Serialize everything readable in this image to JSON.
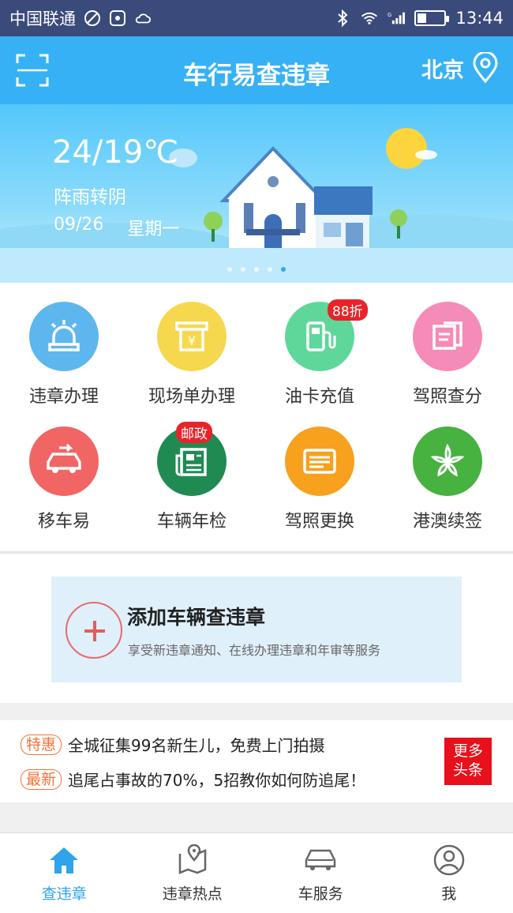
{
  "status_bar": {
    "carrier": "中国联通",
    "time": "13:44",
    "battery_level": 0.35
  },
  "header": {
    "title": "车行易查违章",
    "city": "北京"
  },
  "banner": {
    "temperature": "24/19℃",
    "weather": "阵雨转阴",
    "date": "09/26",
    "weekday": "星期一",
    "slide_count": 5,
    "active_slide": 4
  },
  "grid": {
    "items": [
      {
        "label": "违章办理",
        "icon": "siren-icon",
        "color": "#5db7ee"
      },
      {
        "label": "现场单办理",
        "icon": "receipt-icon",
        "color": "#f5d84e"
      },
      {
        "label": "油卡充值",
        "icon": "fuel-pump-icon",
        "color": "#5fd79b",
        "badge": "88折"
      },
      {
        "label": "驾照查分",
        "icon": "license-book-icon",
        "color": "#f58bb7"
      },
      {
        "label": "移车易",
        "icon": "car-move-icon",
        "color": "#f16565"
      },
      {
        "label": "车辆年检",
        "icon": "newspaper-icon",
        "color": "#1f8b53",
        "badge": "邮政"
      },
      {
        "label": "驾照更换",
        "icon": "id-card-icon",
        "color": "#f7a11e"
      },
      {
        "label": "港澳续签",
        "icon": "bauhinia-icon",
        "color": "#47b23f"
      }
    ]
  },
  "add_vehicle": {
    "title": "添加车辆查违章",
    "subtitle": "享受新违章通知、在线办理违章和年审等服务"
  },
  "news": {
    "items": [
      {
        "tag": "特惠",
        "text": "全城征集99名新生儿，免费上门拍摄"
      },
      {
        "tag": "最新",
        "text": "追尾占事故的70%，5招教你如何防追尾！"
      }
    ],
    "more_line1": "更多",
    "more_line2": "头条"
  },
  "tabs": [
    {
      "label": "查违章",
      "icon": "home-icon",
      "active": true
    },
    {
      "label": "违章热点",
      "icon": "map-pin-icon",
      "active": false
    },
    {
      "label": "车服务",
      "icon": "car-icon",
      "active": false
    },
    {
      "label": "我",
      "icon": "user-icon",
      "active": false
    }
  ],
  "colors": {
    "primary": "#37b1f6",
    "status_bar": "#3a4a7a",
    "accent_red": "#e8101a",
    "tag_orange": "#f3743a"
  }
}
